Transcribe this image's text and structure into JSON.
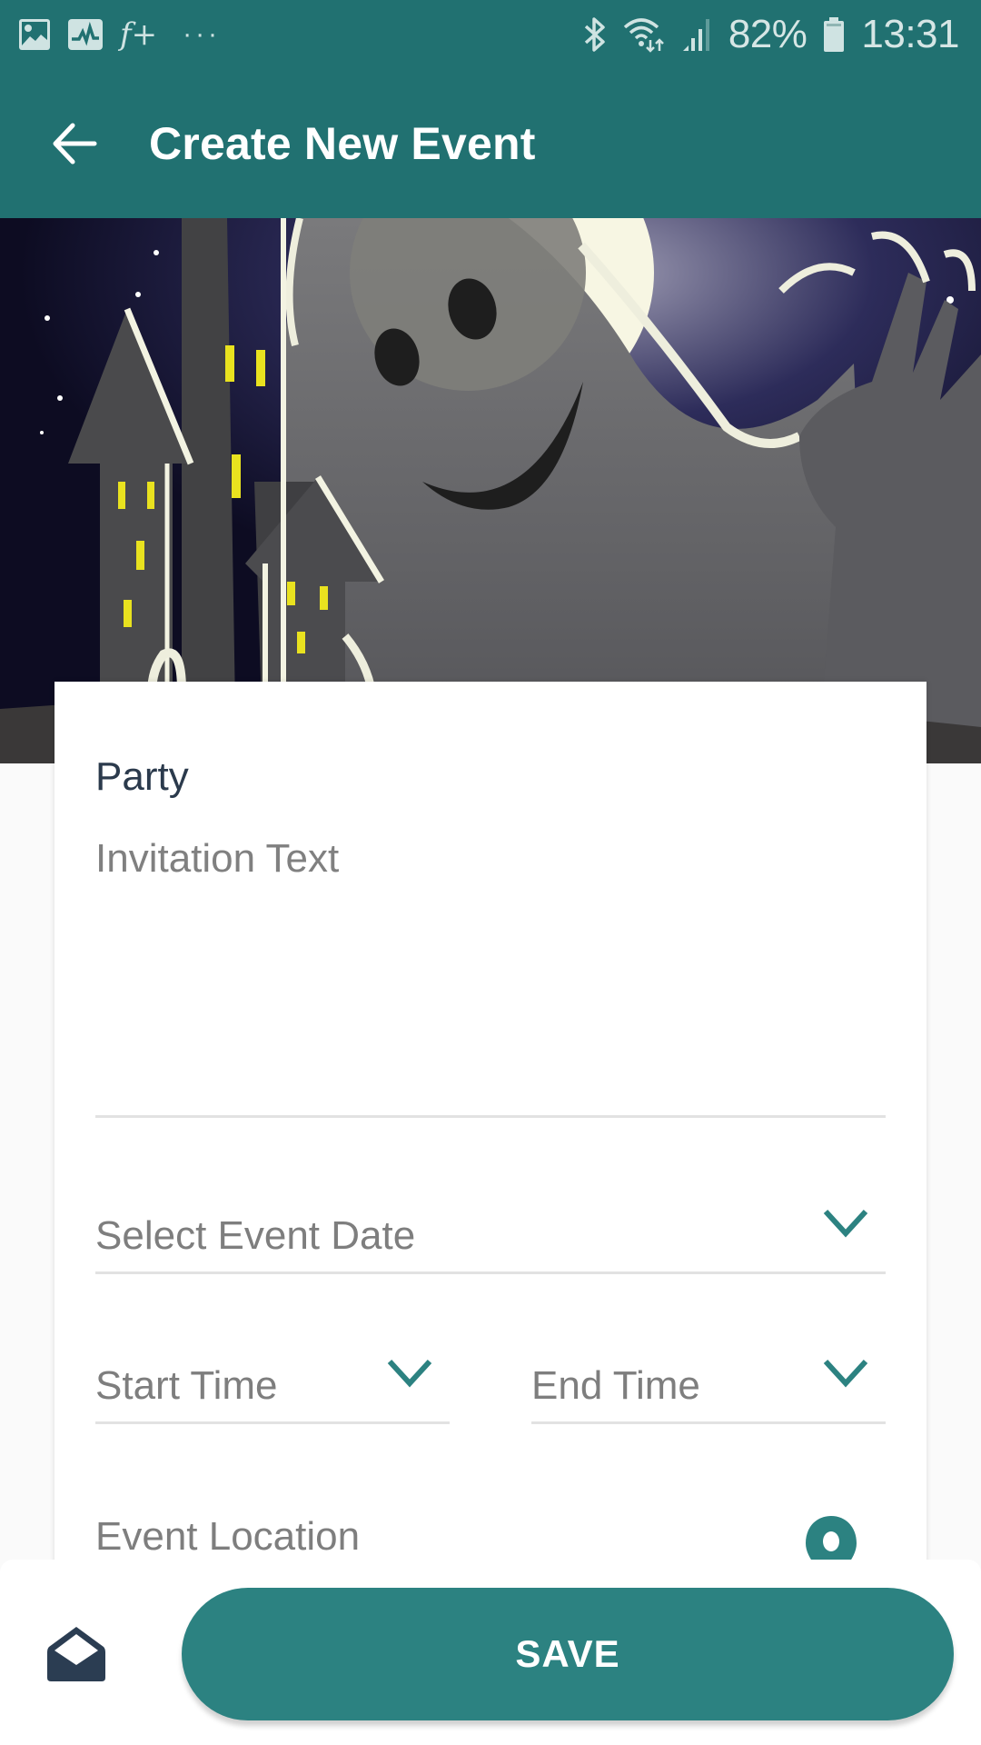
{
  "status_bar": {
    "left_icons": [
      "gallery-icon",
      "health-monitor-icon",
      "f-plus-icon",
      "more-notifications-icon"
    ],
    "more_label": "···",
    "f_plus_label": "f+",
    "right_icons": [
      "bluetooth-icon",
      "wifi-icon",
      "cell-signal-icon",
      "battery-icon"
    ],
    "battery": "82%",
    "time": "13:31"
  },
  "app_bar": {
    "back_icon": "arrow-left-icon",
    "title": "Create New Event"
  },
  "hero": {
    "image": "halloween-ghost-haunted-house-illustration"
  },
  "form": {
    "event_type": "Party",
    "invitation_text": {
      "value": "",
      "placeholder": "Invitation Text"
    },
    "date_field": {
      "label": "Select Event Date",
      "icon": "chevron-down-icon"
    },
    "start_time_field": {
      "label": "Start Time",
      "icon": "chevron-down-icon"
    },
    "end_time_field": {
      "label": "End Time",
      "icon": "chevron-down-icon"
    },
    "location_field": {
      "label": "Event Location",
      "icon": "map-pin-icon"
    }
  },
  "bottom_bar": {
    "preview_icon": "open-envelope-icon",
    "save_label": "SAVE"
  },
  "colors": {
    "primary": "#217171",
    "accent": "#2c8281",
    "title_text": "#2b3a4c",
    "hint_text": "#7e7e7e",
    "divider": "#e2e2e2"
  }
}
